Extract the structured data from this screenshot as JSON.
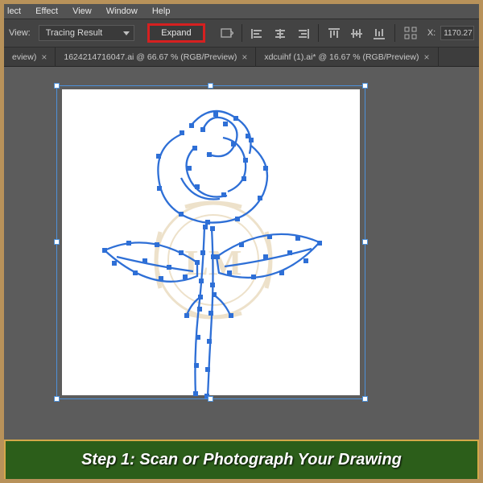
{
  "menu": {
    "items": [
      "lect",
      "Effect",
      "View",
      "Window",
      "Help"
    ]
  },
  "toolbar": {
    "view_label": "View:",
    "view_dropdown": "Tracing Result",
    "expand_label": "Expand",
    "x_label": "X:",
    "x_value": "1170.27"
  },
  "tabs": [
    {
      "label": "eview)",
      "close": "×"
    },
    {
      "label": "1624214716047.ai @ 66.67 % (RGB/Preview)",
      "close": "×"
    },
    {
      "label": "xdcuihf (1).ai* @ 16.67 % (RGB/Preview)",
      "close": "×"
    }
  ],
  "caption": "Step 1: Scan or Photograph Your Drawing",
  "colors": {
    "accent": "#2e6fd6",
    "highlight": "#d62020",
    "frame": "#b8925a",
    "caption_bg": "#2c5e1a"
  },
  "watermark": {
    "text": "LM"
  }
}
